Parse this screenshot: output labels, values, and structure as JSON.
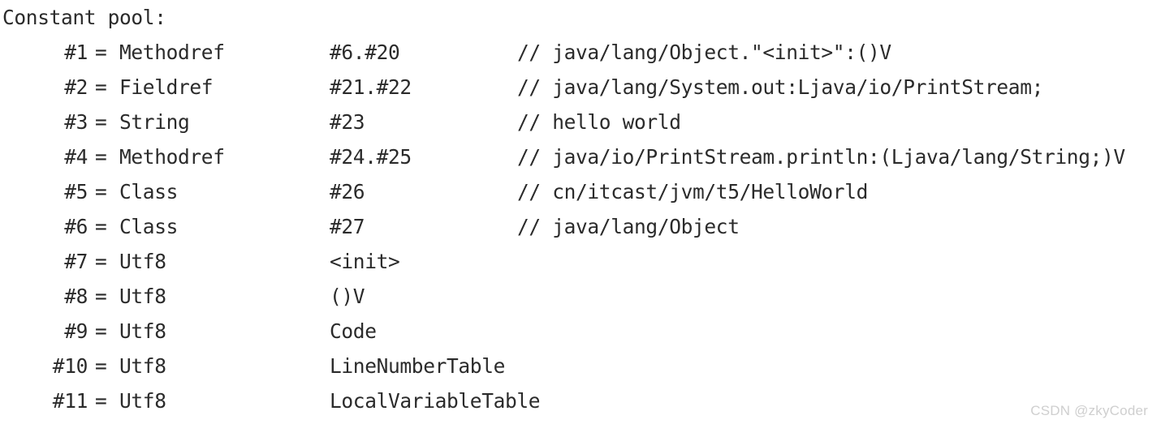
{
  "output": {
    "header": "Constant pool:",
    "equals_sign": "=",
    "rows": [
      {
        "index": "#1",
        "tag": "Methodref",
        "ref": "#6.#20",
        "comment": "// java/lang/Object.\"<init>\":()V"
      },
      {
        "index": "#2",
        "tag": "Fieldref",
        "ref": "#21.#22",
        "comment": "// java/lang/System.out:Ljava/io/PrintStream;"
      },
      {
        "index": "#3",
        "tag": "String",
        "ref": "#23",
        "comment": "// hello world"
      },
      {
        "index": "#4",
        "tag": "Methodref",
        "ref": "#24.#25",
        "comment": "// java/io/PrintStream.println:(Ljava/lang/String;)V"
      },
      {
        "index": "#5",
        "tag": "Class",
        "ref": "#26",
        "comment": "// cn/itcast/jvm/t5/HelloWorld"
      },
      {
        "index": "#6",
        "tag": "Class",
        "ref": "#27",
        "comment": "// java/lang/Object"
      },
      {
        "index": "#7",
        "tag": "Utf8",
        "ref": "<init>",
        "comment": ""
      },
      {
        "index": "#8",
        "tag": "Utf8",
        "ref": "()V",
        "comment": ""
      },
      {
        "index": "#9",
        "tag": "Utf8",
        "ref": "Code",
        "comment": ""
      },
      {
        "index": "#10",
        "tag": "Utf8",
        "ref": "LineNumberTable",
        "comment": ""
      },
      {
        "index": "#11",
        "tag": "Utf8",
        "ref": "LocalVariableTable",
        "comment": ""
      }
    ]
  },
  "watermark": {
    "text": "CSDN @zkyCoder"
  },
  "colors": {
    "background": "#ffffff",
    "text": "#2b2b2b",
    "watermark": "#cfcfcf"
  }
}
